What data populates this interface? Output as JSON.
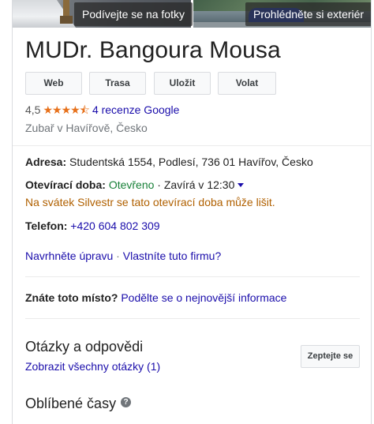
{
  "photos": {
    "left_label": "Podívejte se na fotky",
    "right_label": "Prohlédněte si exteriér"
  },
  "business": {
    "name": "MUDr. Bangoura Mousa",
    "rating": "4,5",
    "stars_icon": "★★★★⯪",
    "stars_value": 4.5,
    "reviews_link": "4 recenze Google",
    "category": "Zubař v Havířově, Česko"
  },
  "actions": {
    "web": "Web",
    "route": "Trasa",
    "save": "Uložit",
    "call": "Volat"
  },
  "details": {
    "address_label": "Adresa:",
    "address_value": "Studentská 1554, Podlesí, 736 01 Havířov, Česko",
    "hours_label": "Otevírací doba:",
    "hours_open": "Otevřeno",
    "hours_sep": " · ",
    "hours_closes": "Zavírá v 12:30",
    "holiday_notice": "Na svátek Silvestr se tato otevírací doba může lišit.",
    "phone_label": "Telefon:",
    "phone_value": "+420 604 802 309",
    "suggest_edit": "Navrhněte úpravu",
    "links_sep": " · ",
    "own_business": "Vlastníte tuto firmu?"
  },
  "know_place": {
    "question": "Znáte toto místo?",
    "share_link": "Podělte se o nejnovější informace"
  },
  "qa": {
    "title": "Otázky a odpovědi",
    "show_all": "Zobrazit všechny otázky (1)",
    "ask_button": "Zeptejte se"
  },
  "popular_times": {
    "title": "Oblíbené časy",
    "help_icon": "?"
  },
  "colors": {
    "link": "#1a0dab",
    "open": "#188038",
    "warning": "#b06000",
    "stars": "#e7711b"
  }
}
